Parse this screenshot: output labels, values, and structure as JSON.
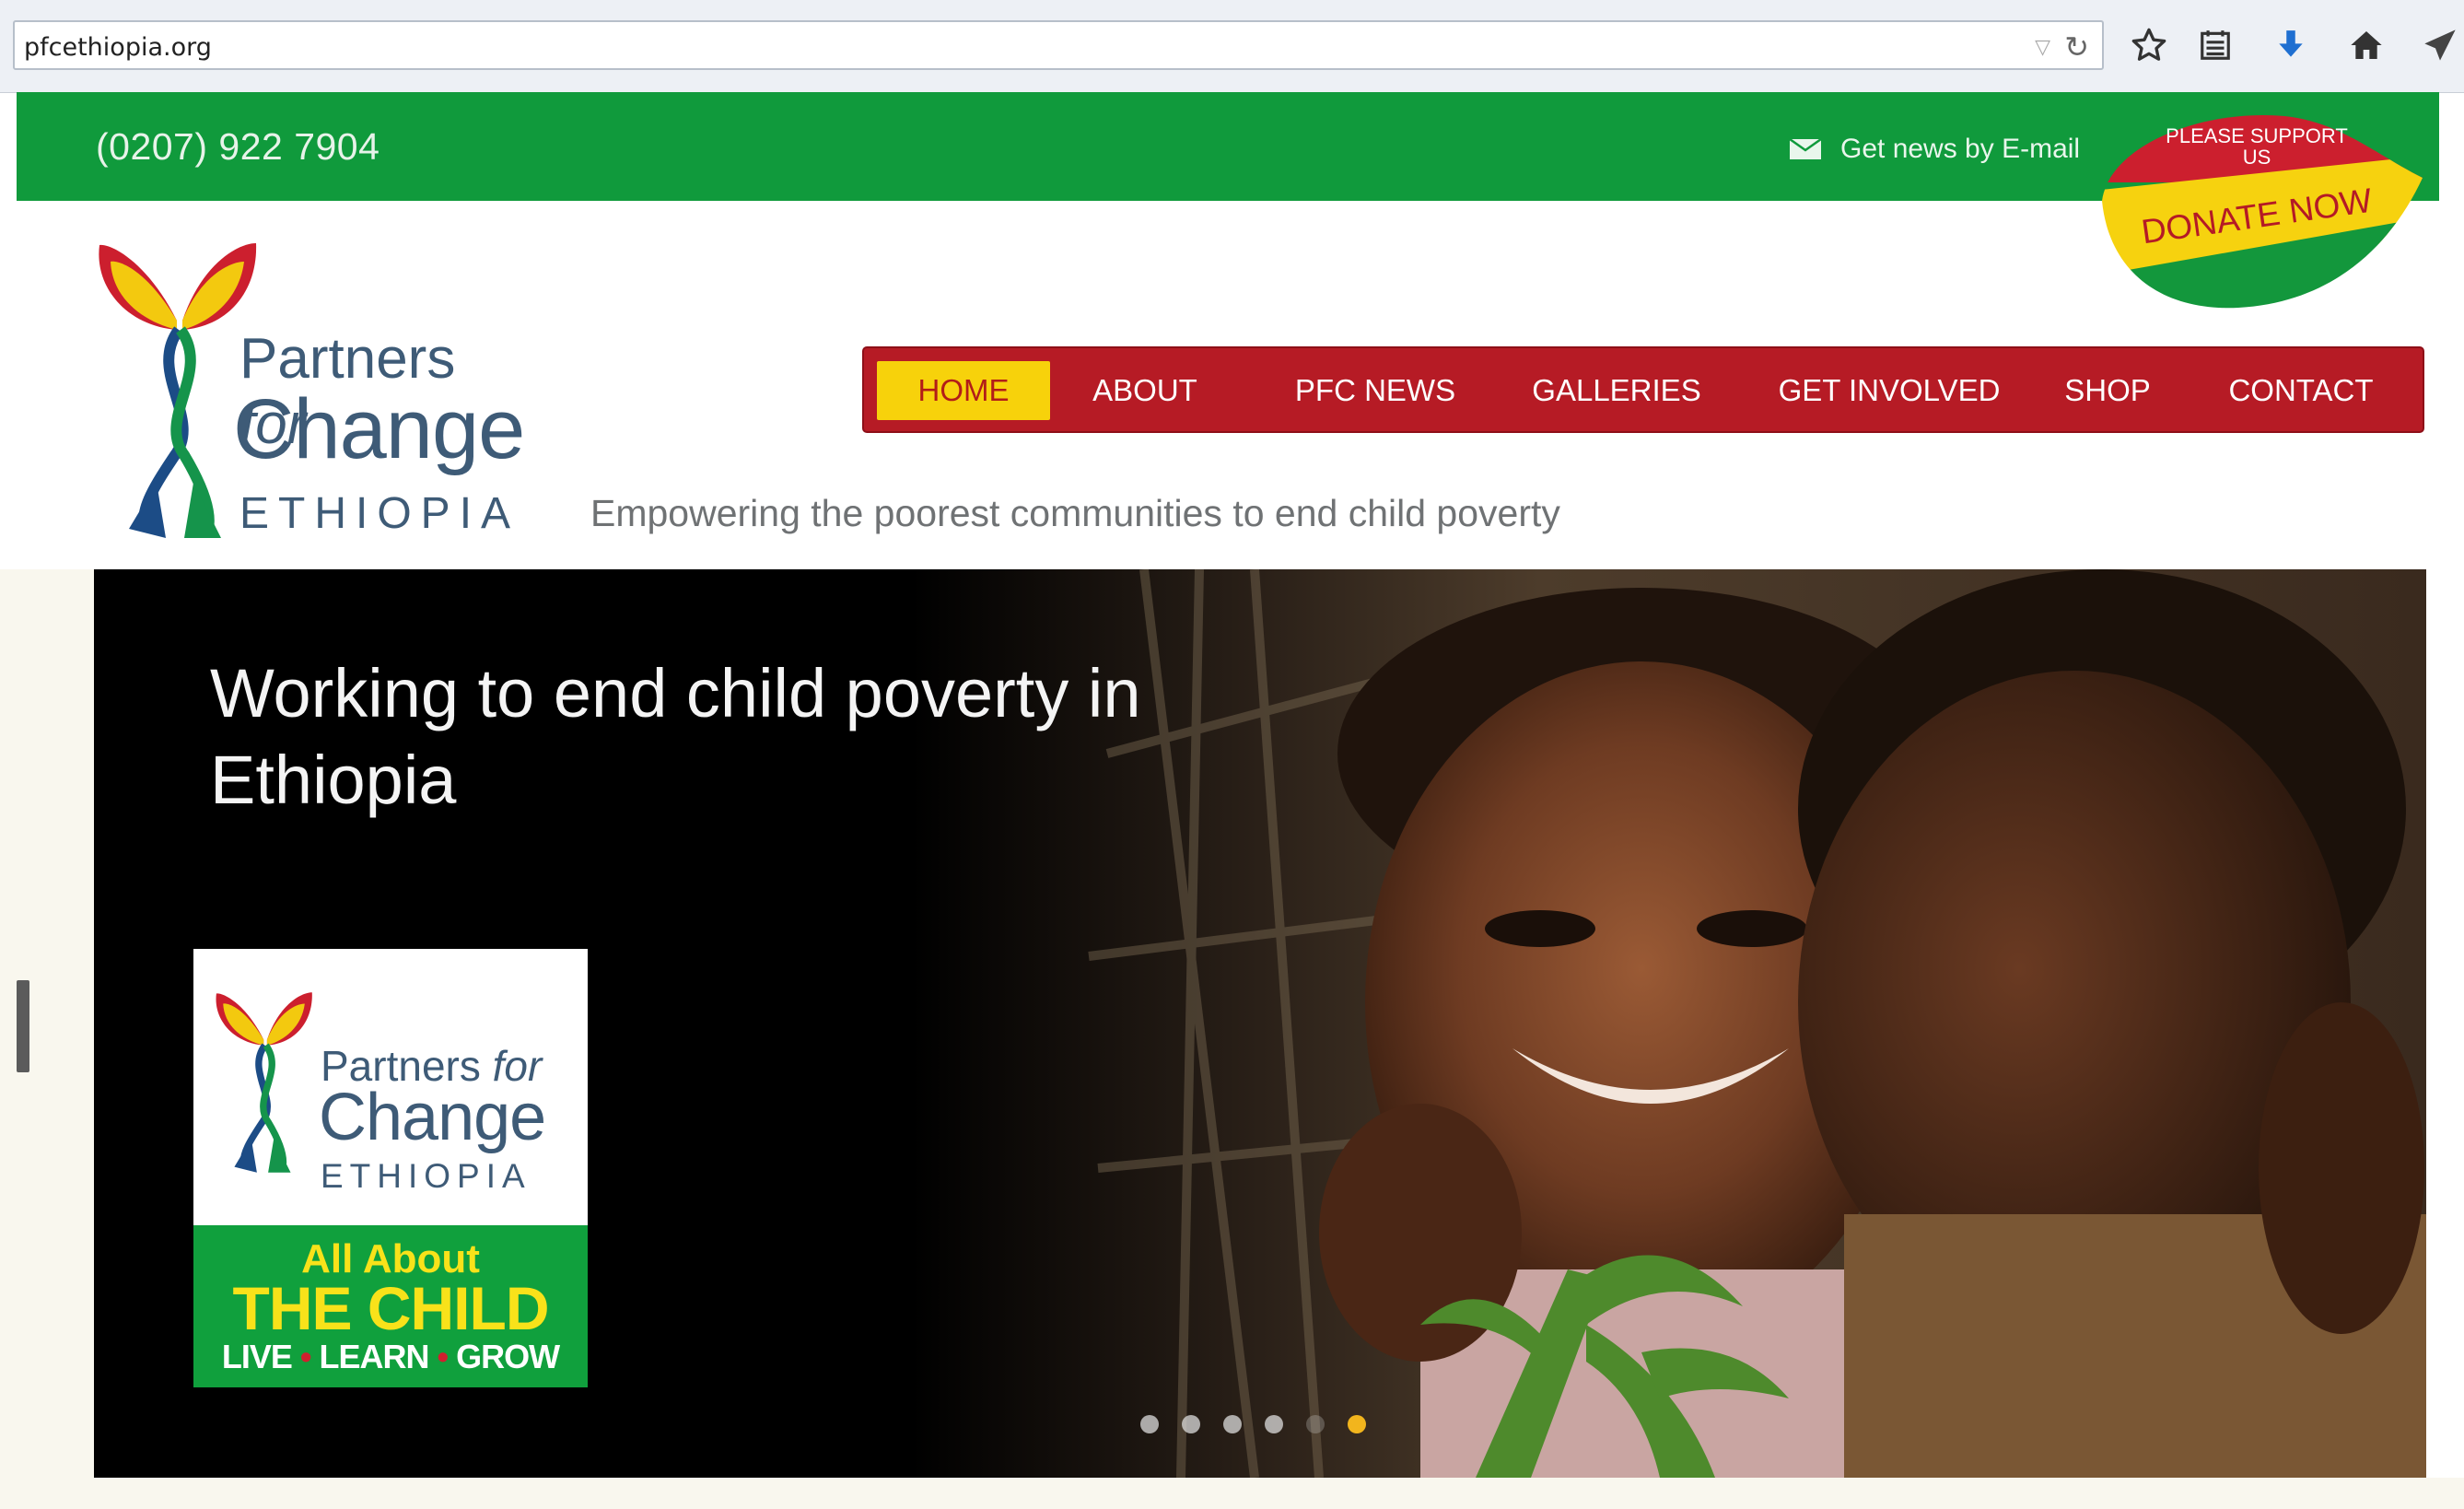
{
  "browser": {
    "url": "pfcethiopia.org",
    "toolbar_icons": [
      "bookmark-star-icon",
      "reading-list-icon",
      "download-icon",
      "home-icon",
      "send-icon"
    ]
  },
  "topbar": {
    "phone": "(0207) 922 7904",
    "newsletter_label": "Get news by E-mail",
    "donate_top": "PLEASE SUPPORT US",
    "donate_button": "DONATE NOW"
  },
  "logo": {
    "line1": "Partners",
    "line1_italic": "for",
    "line2": "Change",
    "line3": "ETHIOPIA"
  },
  "nav": {
    "items": [
      "HOME",
      "ABOUT",
      "PFC NEWS",
      "GALLERIES",
      "GET INVOLVED",
      "SHOP",
      "CONTACT"
    ],
    "active": "HOME"
  },
  "tagline": "Empowering the poorest communities to end child poverty",
  "hero": {
    "headline": "Working to end child poverty in Ethiopia",
    "card": {
      "line1": "Partners",
      "line1_italic": "for",
      "line2": "Change",
      "line3": "ETHIOPIA",
      "band1": "All About",
      "band2": "THE CHILD",
      "band3_a": "LIVE",
      "band3_b": "LEARN",
      "band3_c": "GROW"
    },
    "slides": 6,
    "active_slide": 6
  },
  "colors": {
    "green": "#109a3c",
    "nav_red": "#b61b25",
    "active_yellow": "#f7d20b",
    "logo_blue": "#3e5b77"
  }
}
